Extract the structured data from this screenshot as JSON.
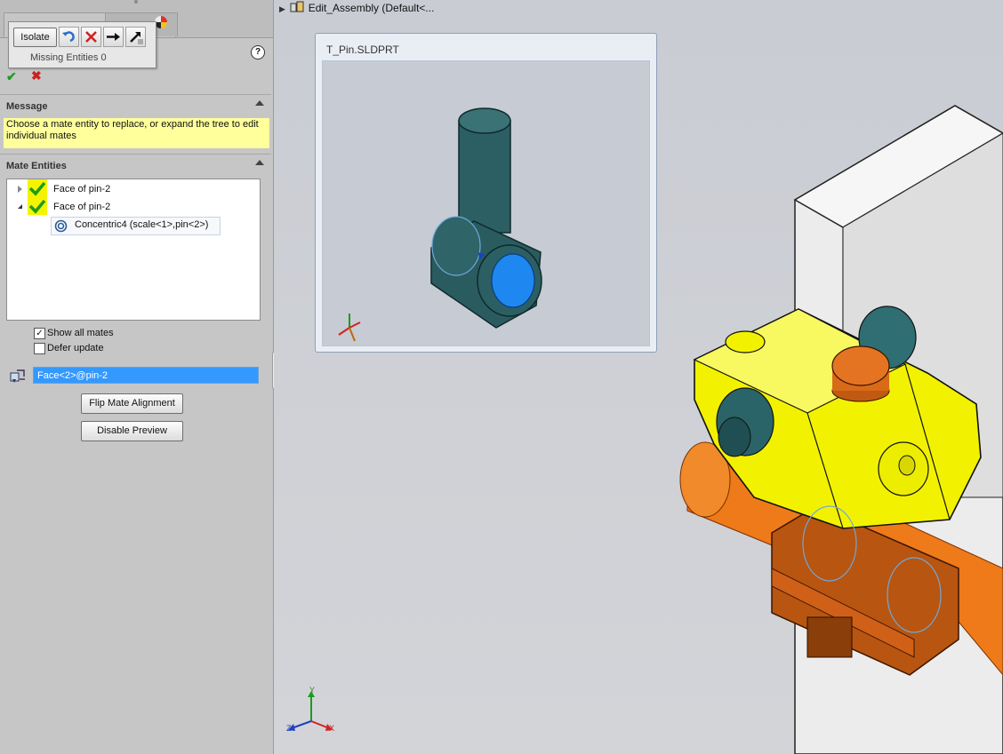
{
  "isolate_popup": {
    "isolate_label": "Isolate",
    "missing_entities": "Missing Entities 0"
  },
  "help_symbol": "?",
  "message": {
    "title": "Message",
    "text": "Choose a mate entity to replace, or expand the tree to edit individual mates"
  },
  "mate_entities": {
    "title": "Mate Entities",
    "items": [
      {
        "label": "Face of pin-2",
        "expanded": false
      },
      {
        "label": "Face of pin-2",
        "expanded": true,
        "children": [
          {
            "label": "Concentric4 (scale<1>,pin<2>)"
          }
        ]
      }
    ]
  },
  "options": {
    "show_all_mates": "Show all mates",
    "show_all_mates_checked": true,
    "defer_update": "Defer update",
    "defer_update_checked": false
  },
  "selected_entity": "Face<2>@pin-2",
  "buttons": {
    "flip_mate_alignment": "Flip Mate Alignment",
    "disable_preview": "Disable Preview"
  },
  "graphics": {
    "assembly_root": "Edit_Assembly  (Default<...",
    "preview_title": "T_Pin.SLDPRT",
    "triad_labels": {
      "x": "X",
      "y": "Y",
      "z": "Z"
    }
  },
  "colors": {
    "message_bg": "#ffff9c",
    "selection_blue": "#3399ff",
    "part_teal": "#285e63",
    "part_yellow": "#f2f200",
    "part_orange": "#e86a10",
    "check_green": "#1e9d1e"
  }
}
